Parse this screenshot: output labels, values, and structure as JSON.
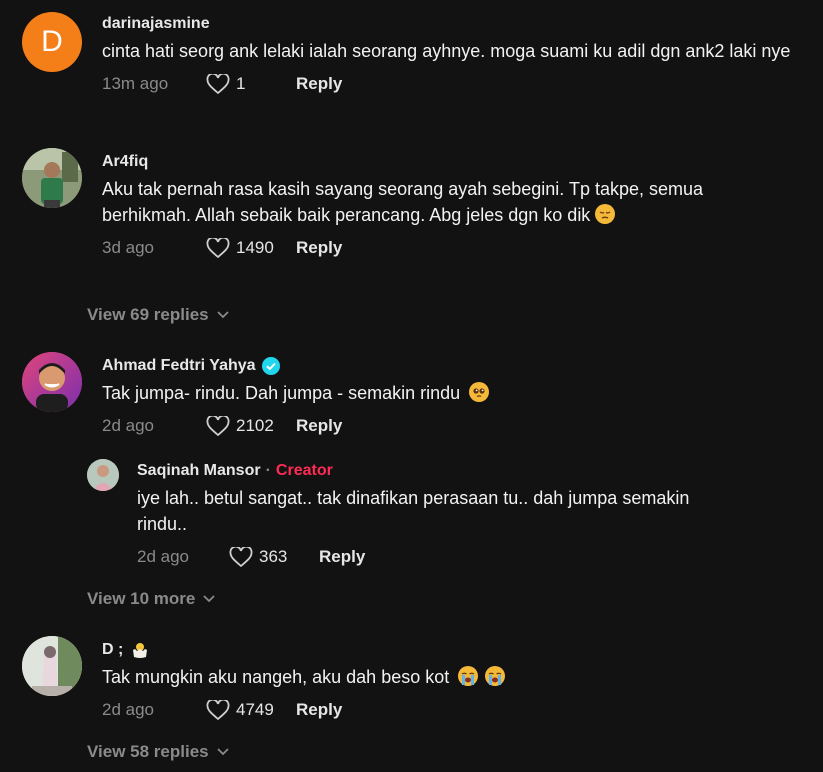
{
  "comments": [
    {
      "username": "darinajasmine",
      "avatar_letter": "D",
      "text": "cinta hati seorg ank lelaki ialah seorang ayhnye. moga suami ku adil dgn ank2 laki nye",
      "time": "13m ago",
      "likes": "1",
      "reply_label": "Reply"
    },
    {
      "username": "Ar4fiq",
      "text": "Aku tak pernah rasa kasih sayang seorang ayah sebegini. Tp takpe, semua berhikmah. Allah sebaik baik perancang. Abg jeles dgn ko dik",
      "emoji": "pensive-face",
      "time": "3d ago",
      "likes": "1490",
      "reply_label": "Reply",
      "view_replies": "View 69 replies"
    },
    {
      "username": "Ahmad Fedtri Yahya",
      "verified": true,
      "text": "Tak jumpa- rindu. Dah jumpa - semakin rindu",
      "emoji": "pleading-face",
      "time": "2d ago",
      "likes": "2102",
      "reply_label": "Reply",
      "reply": {
        "username": "Saqinah Mansor",
        "separator": "·",
        "badge": "Creator",
        "text": "iye lah.. betul sangat.. tak dinafikan perasaan tu.. dah jumpa semakin rindu..",
        "time": "2d ago",
        "likes": "363",
        "reply_label": "Reply"
      },
      "view_more": "View 10 more"
    },
    {
      "username": "D ;",
      "username_emoji": "hatching-chick",
      "text": "Tak mungkin aku nangeh, aku dah beso kot",
      "emoji": "loudly-crying-face",
      "time": "2d ago",
      "likes": "4749",
      "reply_label": "Reply",
      "view_replies": "View 58 replies"
    }
  ],
  "colors": {
    "background": "#121212",
    "creator_badge": "#fe2c55",
    "verified": "#20d5ec",
    "avatar_letter_bg": "#f47e17"
  }
}
